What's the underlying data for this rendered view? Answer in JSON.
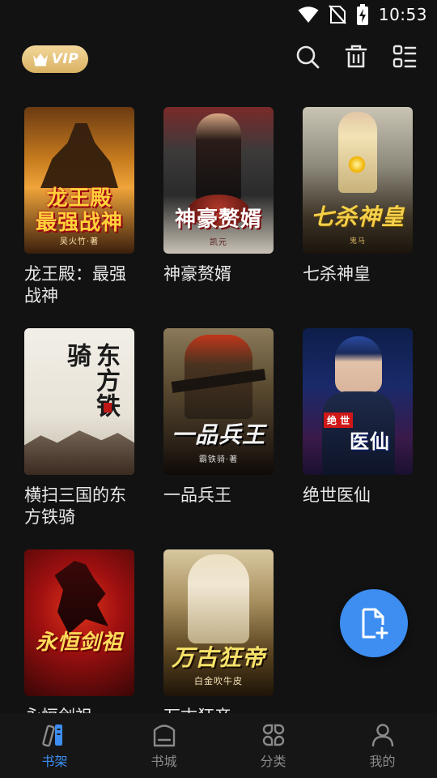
{
  "status_bar": {
    "time": "10:53"
  },
  "header": {
    "vip_label": "VIP",
    "icons": [
      "search-icon",
      "trash-icon",
      "list-view-icon"
    ]
  },
  "books": [
    {
      "title": "龙王殿：最强战神",
      "cover_text": "龙王殿\n最强战神",
      "cover_author": "吴火竹·著"
    },
    {
      "title": "神豪赘婿",
      "cover_text": "神豪赘婿",
      "cover_author": "凯元"
    },
    {
      "title": "七杀神皇",
      "cover_text": "七杀神皇",
      "cover_author": "鬼马"
    },
    {
      "title": "横扫三国的东方铁骑",
      "cover_text": "东方铁骑",
      "cover_author": ""
    },
    {
      "title": "一品兵王",
      "cover_text": "一品兵王",
      "cover_author": "霸铁骑·著"
    },
    {
      "title": "绝世医仙",
      "cover_text": "绝世 医仙",
      "cover_author": ""
    },
    {
      "title": "永恒剑祖",
      "cover_text": "永恒剑祖",
      "cover_author": ""
    },
    {
      "title": "万古狂帝",
      "cover_text": "万古狂帝",
      "cover_author": "白金吹牛皮"
    }
  ],
  "fab": {
    "icon": "add-file-icon"
  },
  "nav": [
    {
      "label": "书架",
      "icon": "bookshelf-icon",
      "active": true
    },
    {
      "label": "书城",
      "icon": "bookstore-icon",
      "active": false
    },
    {
      "label": "分类",
      "icon": "category-icon",
      "active": false
    },
    {
      "label": "我的",
      "icon": "profile-icon",
      "active": false
    }
  ],
  "colors": {
    "accent": "#3d8ef0",
    "vip_gold": "#d9b263",
    "background": "#121212"
  }
}
